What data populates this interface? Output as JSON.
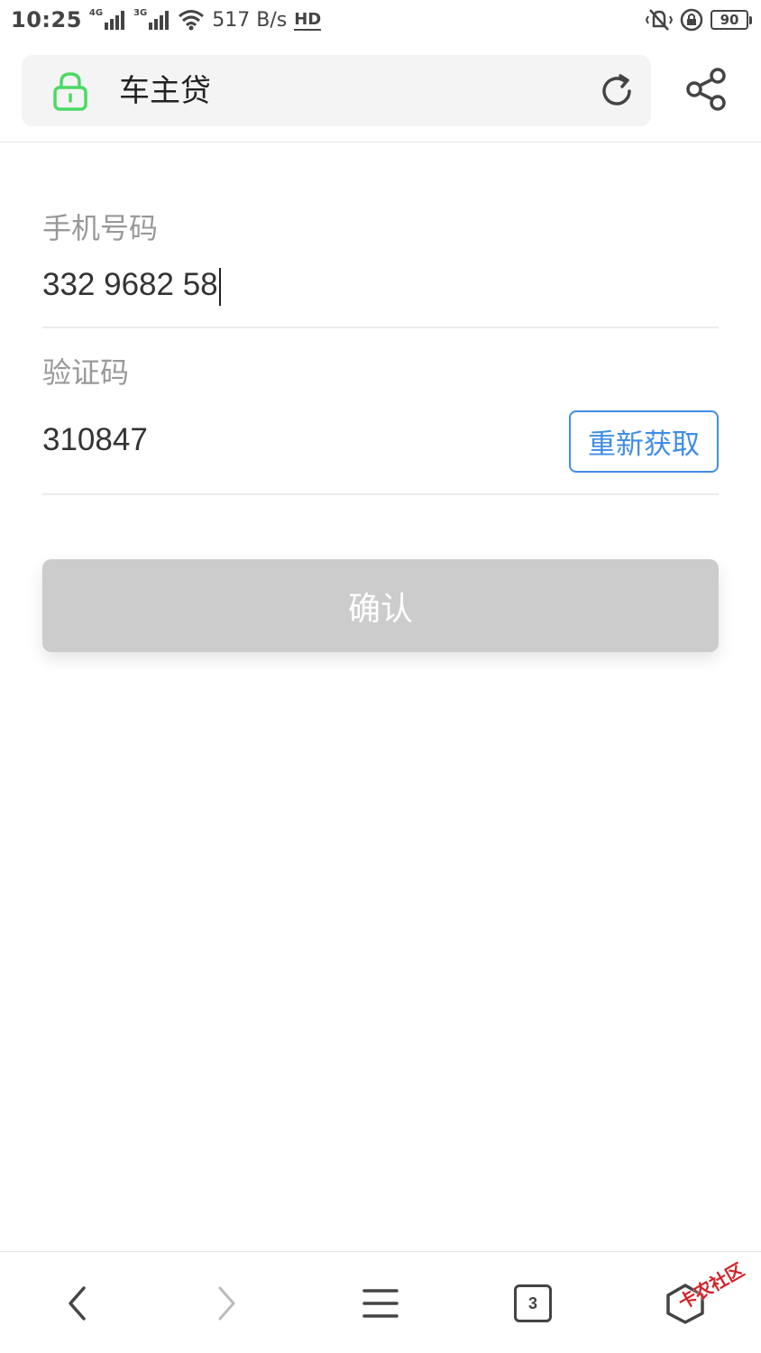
{
  "status_bar": {
    "time": "10:25",
    "net1": "4G",
    "net2": "3G",
    "speed": "517 B/s",
    "hd_label": "HD",
    "battery": "90"
  },
  "address_bar": {
    "title": "车主贷",
    "lock_color": "#4cd964"
  },
  "form": {
    "phone_label": "手机号码",
    "phone_value": "332 9682 58",
    "code_label": "验证码",
    "code_value": "310847",
    "resend_label": "重新获取",
    "confirm_label": "确认"
  },
  "bottom_nav": {
    "tab_count": "3"
  },
  "watermark": "卡农社区",
  "colors": {
    "accent": "#3f8de8",
    "disabled_button": "#cccccc"
  }
}
